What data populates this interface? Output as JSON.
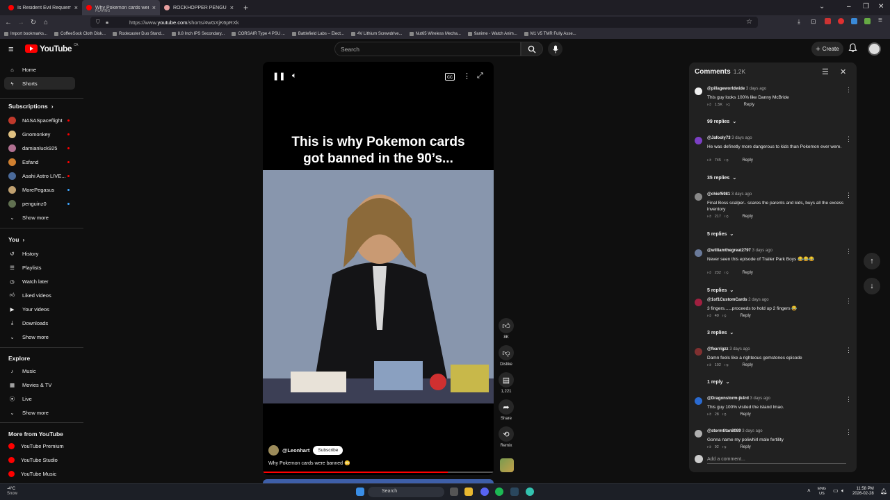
{
  "browser": {
    "tabs": [
      {
        "title": "Is Resident Evil Requiem Good",
        "sub": "",
        "color": "#ff0000",
        "active": false
      },
      {
        "title": "Why Pokemon cards were bann",
        "sub": "PLAYING",
        "color": "#ff0000",
        "active": true
      },
      {
        "title": "ROCKHOPPER PENGUIN at Du",
        "sub": "",
        "color": "#e8a0a0",
        "active": false
      }
    ],
    "url_prefix": "https://www.",
    "url_domain": "youtube.com",
    "url_path": "/shorts/4wGXjK6pRXk",
    "bookmarks": [
      "Import bookmarks...",
      "CoffeeSock Cloth Disk...",
      "Rodecaster Duo Stand...",
      "8.8 Inch IPS Secondary...",
      "CORSAIR Type 4 PSU ...",
      "Battlefield Labs – Elect...",
      "4V Lithium Screwdrive...",
      "Nut65 Wireless Mecha...",
      "9anime - Watch Anim...",
      "M1 V5 TMR Fully Asse..."
    ]
  },
  "masthead": {
    "logo_text": "YouTube",
    "logo_region": "CA",
    "search_placeholder": "Search",
    "create_label": "Create"
  },
  "sidebar": {
    "main": [
      {
        "label": "Home",
        "icon": "home-icon"
      },
      {
        "label": "Shorts",
        "icon": "shorts-icon"
      }
    ],
    "subscriptions_title": "Subscriptions",
    "subscriptions": [
      {
        "label": "NASASpaceflight",
        "color": "#c0392b",
        "dot": "#ff0000"
      },
      {
        "label": "Gnomonkey",
        "color": "#e0c080",
        "dot": "#ff0000"
      },
      {
        "label": "damianluck925",
        "color": "#b07090",
        "dot": "#ff0000"
      },
      {
        "label": "Esfand",
        "color": "#d08030",
        "dot": "#ff0000"
      },
      {
        "label": "Asahi Astro LIVE...",
        "color": "#4a6a9a",
        "dot": "#ff0000"
      },
      {
        "label": "MorePegasus",
        "color": "#c0a070",
        "dot": "#3ea6ff"
      },
      {
        "label": "penguinz0",
        "color": "#607050",
        "dot": "#3ea6ff"
      }
    ],
    "show_more": "Show more",
    "you_title": "You",
    "you_items": [
      {
        "label": "History",
        "icon": "history-icon"
      },
      {
        "label": "Playlists",
        "icon": "playlists-icon"
      },
      {
        "label": "Watch later",
        "icon": "watch-later-icon"
      },
      {
        "label": "Liked videos",
        "icon": "liked-videos-icon"
      },
      {
        "label": "Your videos",
        "icon": "your-videos-icon"
      },
      {
        "label": "Downloads",
        "icon": "downloads-icon"
      }
    ],
    "explore_title": "Explore",
    "explore_items": [
      {
        "label": "Music",
        "icon": "music-icon"
      },
      {
        "label": "Movies & TV",
        "icon": "movies-icon"
      },
      {
        "label": "Live",
        "icon": "live-icon"
      }
    ],
    "more_title": "More from YouTube",
    "more_items": [
      {
        "label": "YouTube Premium"
      },
      {
        "label": "YouTube Studio"
      },
      {
        "label": "YouTube Music"
      }
    ]
  },
  "short": {
    "overlay_title_line1": "This is why Pokemon cards",
    "overlay_title_line2": "got banned in the 90’s...",
    "channel": "@Leonhart",
    "subscribe": "Subscribe",
    "caption": "Why Pokemon cards were banned 😳",
    "progress": 0.8,
    "actions": {
      "like": "8K",
      "dislike": "Dislike",
      "comments": "1,221",
      "share": "Share",
      "remix": "Remix"
    }
  },
  "comments": {
    "title": "Comments",
    "count": "1.2K",
    "add_placeholder": "Add a comment...",
    "reply_label": "Reply",
    "items": [
      {
        "author": "@pillageworldwide",
        "time": "3 days ago",
        "text": "This guy looks 100% like Danny McBride",
        "likes": "1.5K",
        "replies": "99 replies",
        "color": "#f0f0f0"
      },
      {
        "author": "@Jafooly73",
        "time": "3 days ago",
        "text": "He was definetly more dangerous to kids than Pokemon ever were.",
        "likes": "745",
        "replies": "35 replies",
        "color": "#7b3fc4"
      },
      {
        "author": "@chief5981",
        "time": "3 days ago",
        "text": "Final Boss scalper.. scares the parents and kids, buys all the excess inventory",
        "likes": "217",
        "replies": "5 replies",
        "color": "#888888"
      },
      {
        "author": "@williamthegreat2797",
        "time": "3 days ago",
        "text": "Never seen this episode of Trailer Park Boys 😂😂😂",
        "likes": "232",
        "replies": "5 replies",
        "color": "#6a7a9a"
      },
      {
        "author": "@1of1CustomCards",
        "time": "2 days ago",
        "text": "3 fingers......proceeds to hold up 2 fingers 😂",
        "likes": "40",
        "replies": "3 replies",
        "color": "#a02040"
      },
      {
        "author": "@fearrigzz",
        "time": "3 days ago",
        "text": "Damn feels like a righteous gemstones episode",
        "likes": "102",
        "replies": "1 reply",
        "color": "#803030"
      },
      {
        "author": "@Dragonstorm-jk4rd",
        "time": "3 days ago",
        "text": "This guy 100% visited the island lmao.",
        "likes": "28",
        "replies": "",
        "color": "#2a6ad0"
      },
      {
        "author": "@stormtitan8089",
        "time": "3 days ago",
        "text": "Gonna name my poliwhirl male fertility",
        "likes": "92",
        "replies": "",
        "color": "#b0b0b0"
      }
    ]
  },
  "taskbar": {
    "weather_temp": "-4°C",
    "weather_desc": "Snow",
    "search": "Search",
    "lang1": "ENG",
    "lang2": "US",
    "time": "11:58 PM",
    "date": "2026-02-28"
  }
}
